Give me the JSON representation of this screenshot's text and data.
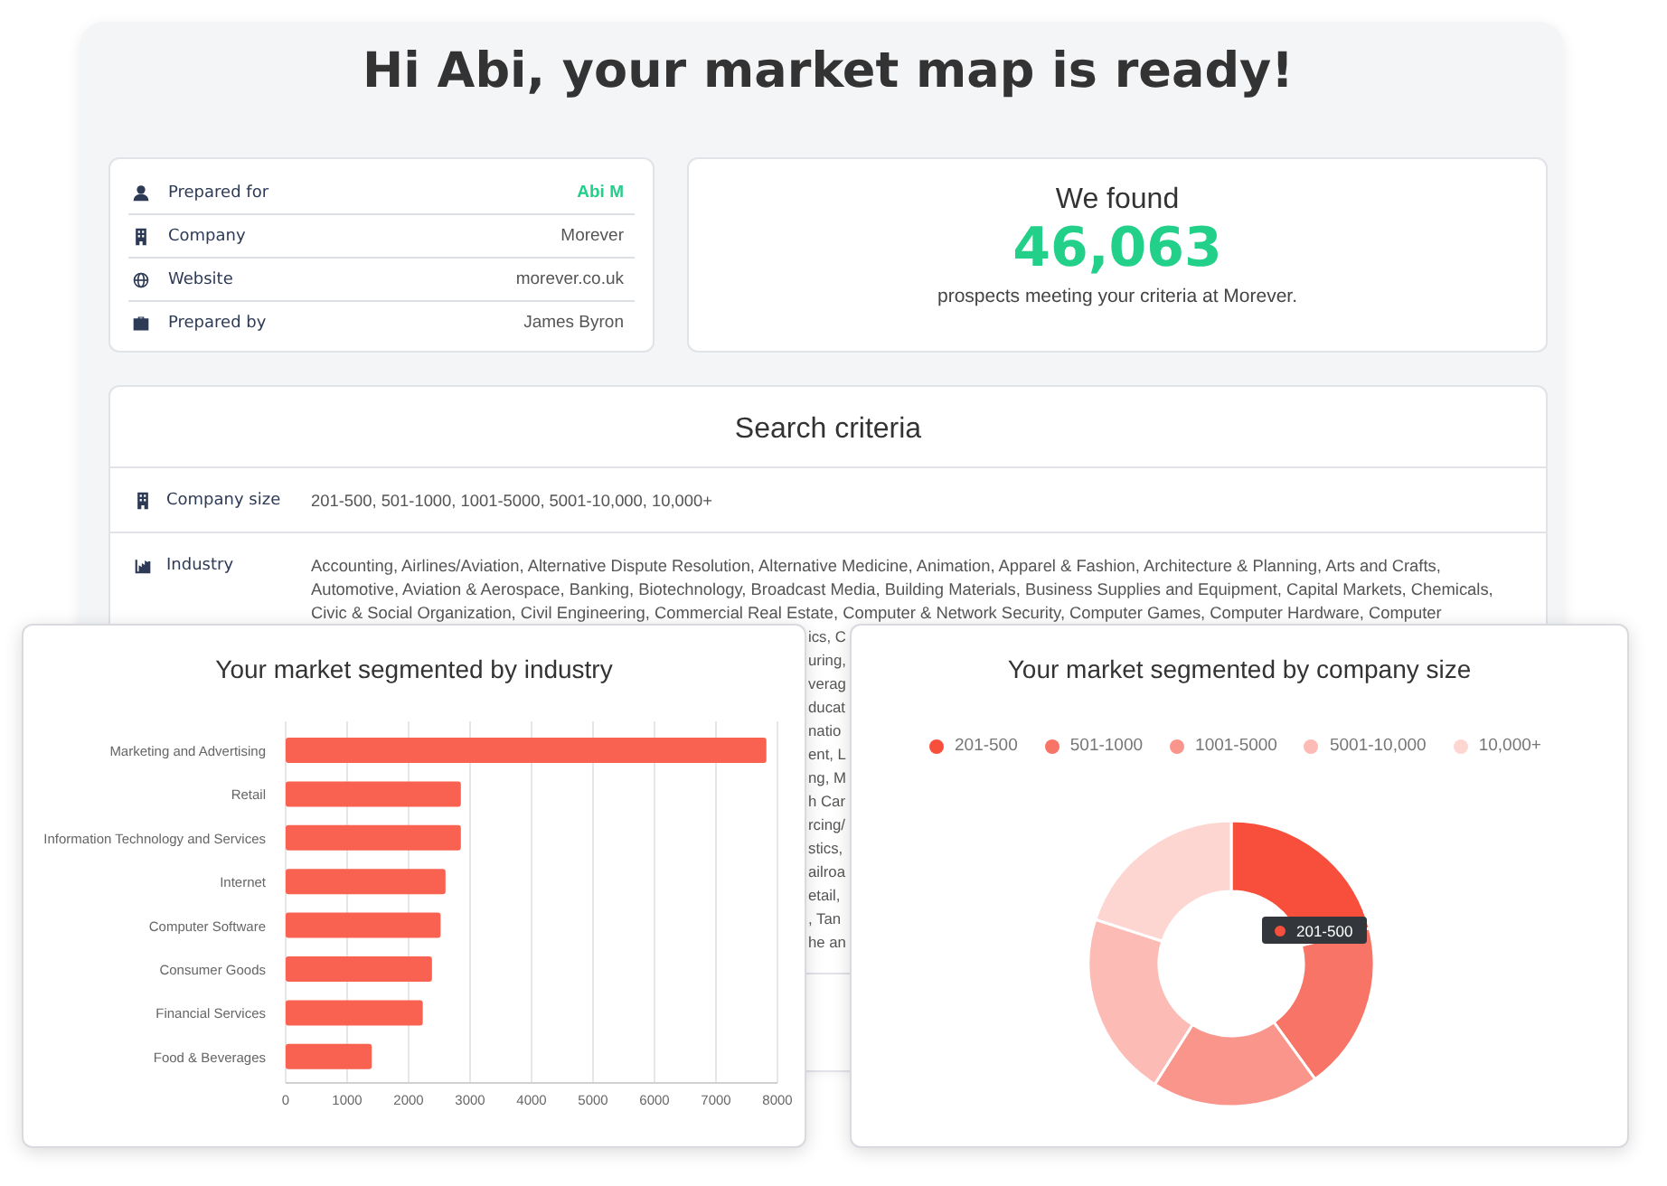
{
  "title": "Hi Abi, your market map is ready!",
  "details": [
    {
      "kind": "person",
      "label": "Prepared for",
      "value": "Abi M",
      "highlight": true
    },
    {
      "kind": "building",
      "label": "Company",
      "value": "Morever",
      "highlight": false
    },
    {
      "kind": "globe",
      "label": "Website",
      "value": "morever.co.uk",
      "highlight": false
    },
    {
      "kind": "briefcase",
      "label": "Prepared by",
      "value": "James Byron",
      "highlight": false
    }
  ],
  "found": {
    "heading": "We found",
    "count": "46,063",
    "caption": "prospects meeting your criteria at Morever."
  },
  "search_criteria": {
    "heading": "Search criteria",
    "rows": [
      {
        "kind": "building",
        "label": "Company size",
        "lines": [
          "201-500, 501-1000, 1001-5000, 5001-10,000, 10,000+"
        ]
      },
      {
        "kind": "chart",
        "label": "Industry",
        "lines": [
          "Accounting, Airlines/Aviation, Alternative Dispute Resolution, Alternative Medicine, Animation, Apparel & Fashion, Architecture & Planning, Arts and Crafts,",
          "Automotive, Aviation & Aerospace, Banking, Biotechnology, Broadcast Media, Building Materials, Business Supplies and Equipment, Capital Markets, Chemicals,",
          "Civic & Social Organization, Civil Engineering, Commercial Real Estate, Computer & Network Security, Computer Games, Computer Hardware, Computer"
        ],
        "fragments": [
          "ics, C",
          "uring,",
          "verag",
          "ducat",
          "natio",
          "ent, L",
          "ng, M",
          "h Car",
          "rcing/",
          "stics,",
          "ailroa",
          "etail,",
          ", Tan",
          "he an"
        ]
      }
    ]
  },
  "industry_chart": {
    "title": "Your market segmented by industry",
    "chart_data": {
      "type": "bar",
      "orientation": "horizontal",
      "categories": [
        "Marketing and Advertising",
        "Retail",
        "Information Technology and Services",
        "Internet",
        "Computer Software",
        "Consumer Goods",
        "Financial Services",
        "Food & Beverages"
      ],
      "series": [
        {
          "color": "#f96251",
          "values": [
            7820,
            2850,
            2850,
            2600,
            2520,
            2380,
            2230,
            1400
          ]
        }
      ],
      "xlim": [
        0,
        8000
      ],
      "xticks": [
        0,
        1000,
        2000,
        3000,
        4000,
        5000,
        6000,
        7000,
        8000
      ],
      "grid": true
    }
  },
  "size_chart": {
    "title": "Your market segmented by company size",
    "slice_colors": [
      {
        "color": "#f74f3c"
      },
      {
        "color": "#f87466"
      },
      {
        "color": "#fa958b"
      },
      {
        "color": "#fcbbb5"
      },
      {
        "color": "#fdd6d2"
      }
    ],
    "chart_data": {
      "type": "donut",
      "categories": [
        "201-500",
        "501-1000",
        "1001-5000",
        "5001-10,000",
        "10,000+"
      ],
      "values": [
        21,
        19,
        19,
        21,
        20
      ]
    },
    "tooltip": {
      "label": "201-500",
      "color": "#f74f3c"
    }
  }
}
